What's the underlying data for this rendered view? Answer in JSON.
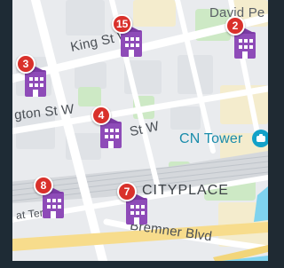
{
  "map": {
    "streets": [
      {
        "id": "king",
        "label": "King St W"
      },
      {
        "id": "wellington",
        "label": "gton St W"
      },
      {
        "id": "front",
        "label": "St W"
      },
      {
        "id": "bremner",
        "label": "Bremner Blvd"
      },
      {
        "id": "terrace",
        "label": "at Terr"
      }
    ],
    "area_label": "CITYPLACE",
    "poi": {
      "label": "CN Tower",
      "icon": "camera-icon"
    },
    "top_right_label": "David Pe",
    "markers": [
      {
        "id": "m15",
        "count": "15"
      },
      {
        "id": "m2",
        "count": "2"
      },
      {
        "id": "m3",
        "count": "3"
      },
      {
        "id": "m4",
        "count": "4"
      },
      {
        "id": "m8",
        "count": "8"
      },
      {
        "id": "m7",
        "count": "7"
      }
    ],
    "colors": {
      "badge": "#d9312b",
      "building": "#8e4bb8",
      "water": "#7fd3ee",
      "park": "#cde9c5",
      "road": "#ffffff",
      "block": "#ebedf0",
      "poi_text": "#1a8cab"
    }
  }
}
